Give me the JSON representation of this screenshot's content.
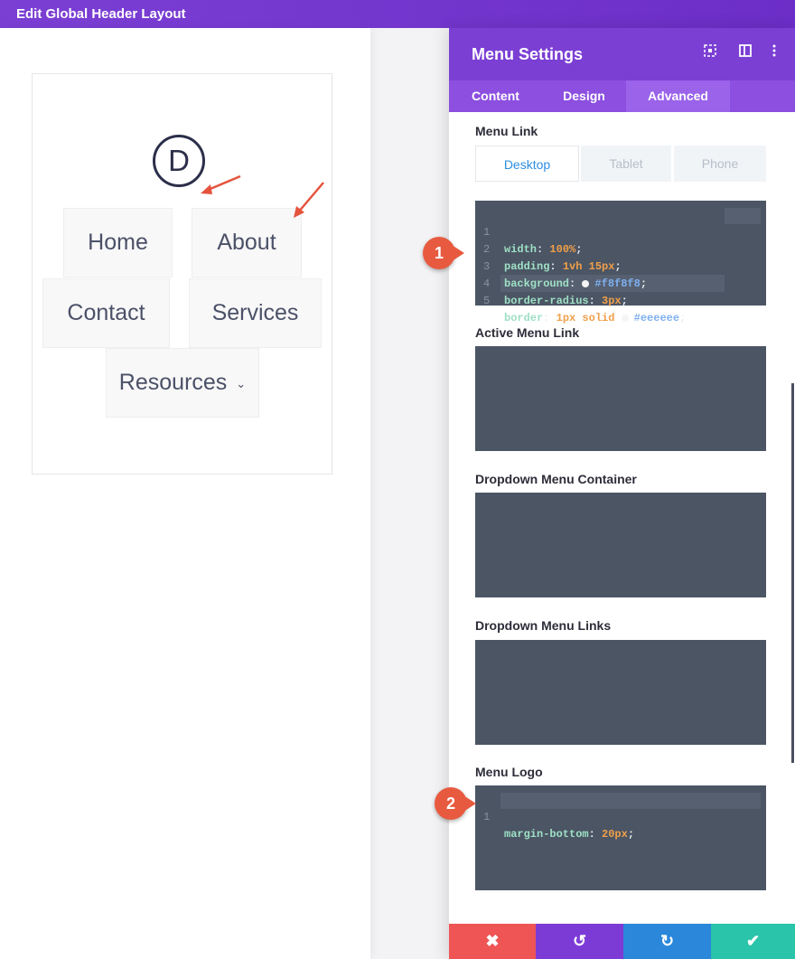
{
  "topbar": {
    "title": "Edit Global Header Layout"
  },
  "preview": {
    "logo_letter": "D",
    "menu": [
      {
        "label": "Home"
      },
      {
        "label": "About"
      },
      {
        "label": "Contact"
      },
      {
        "label": "Services"
      },
      {
        "label": "Resources",
        "has_dropdown": true
      }
    ]
  },
  "panel": {
    "title": "Menu Settings",
    "header_icons": [
      "focus-icon",
      "split-view-icon",
      "more-vertical-icon"
    ],
    "tabs": [
      {
        "label": "Content",
        "active": false
      },
      {
        "label": "Design",
        "active": false
      },
      {
        "label": "Advanced",
        "active": true
      }
    ],
    "sections": {
      "menu_link": {
        "label": "Menu Link",
        "device_tabs": [
          {
            "label": "Desktop",
            "active": true
          },
          {
            "label": "Tablet",
            "active": false
          },
          {
            "label": "Phone",
            "active": false
          }
        ],
        "code": [
          {
            "n": "1",
            "prop": "width",
            "val": "100%"
          },
          {
            "n": "2",
            "prop": "padding",
            "val": "1vh 15px"
          },
          {
            "n": "3",
            "prop": "background",
            "val": "#f8f8f8"
          },
          {
            "n": "4",
            "prop": "border-radius",
            "val": "3px"
          },
          {
            "n": "5",
            "prop": "border",
            "val": "1px solid",
            "hex": "#eeeeee"
          }
        ]
      },
      "active_menu_link": {
        "label": "Active Menu Link"
      },
      "dropdown_container": {
        "label": "Dropdown Menu Container"
      },
      "dropdown_links": {
        "label": "Dropdown Menu Links"
      },
      "menu_logo": {
        "label": "Menu Logo",
        "code": [
          {
            "n": "1",
            "prop": "margin-bottom",
            "val": "20px"
          }
        ]
      }
    }
  },
  "annotations": {
    "badge_1": "1",
    "badge_2": "2"
  },
  "footer": {
    "cancel_icon": "✖",
    "undo_icon": "↺",
    "redo_icon": "↻",
    "save_icon": "✔"
  },
  "colors": {
    "brand_purple": "#7b3fd4",
    "cancel": "#ef5555",
    "undo": "#7d3bd6",
    "redo": "#2b87da",
    "save": "#29c4a9",
    "annotation": "#e85a3f"
  }
}
